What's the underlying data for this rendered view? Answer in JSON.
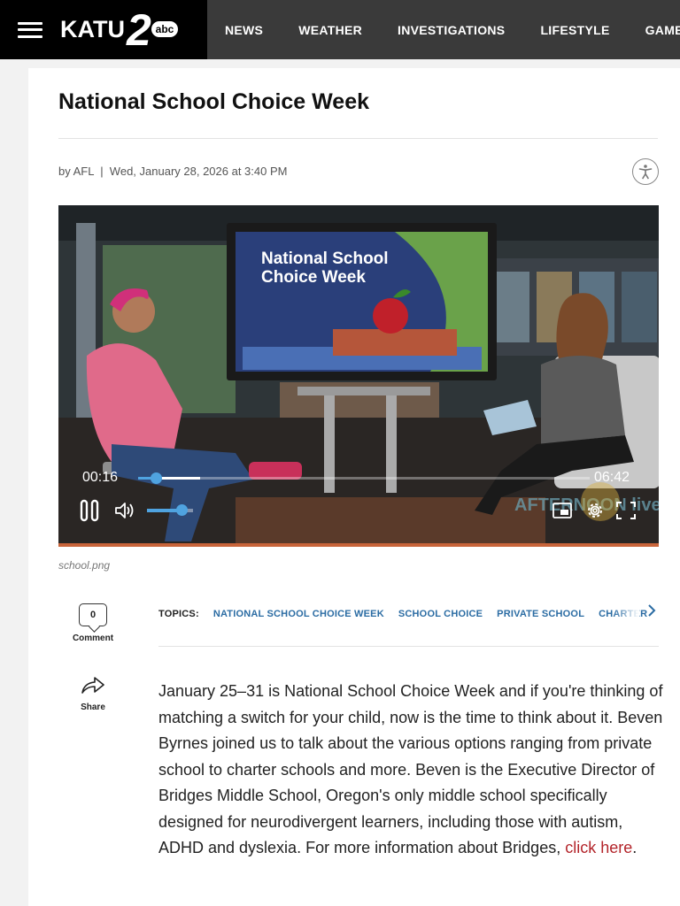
{
  "header": {
    "brand": "KATU",
    "brand_number": "2",
    "brand_network": "abc",
    "nav": [
      "NEWS",
      "WEATHER",
      "INVESTIGATIONS",
      "LIFESTYLE",
      "GAME CEN"
    ]
  },
  "article": {
    "title": "National School Choice Week",
    "byline": "by AFL  |  Wed, January 28, 2026 at 3:40 PM",
    "video": {
      "screen_text_line1": "National School",
      "screen_text_line2": "Choice Week",
      "watermark": "AFTERNOON live",
      "current_time": "00:16",
      "duration": "06:42",
      "progress_fraction": 0.04,
      "volume_fraction": 0.75
    },
    "caption": "school.png",
    "comment_count": "0",
    "comment_label": "Comment",
    "share_label": "Share",
    "topics_label": "TOPICS:",
    "topics": [
      "NATIONAL SCHOOL CHOICE WEEK",
      "SCHOOL CHOICE",
      "PRIVATE SCHOOL",
      "CHARTER"
    ],
    "body_text": "January 25–31 is National School Choice Week and if you're thinking of matching a switch for your child, now is the time to think about it. Beven Byrnes joined us to talk about the various options ranging from private school to charter schools and more. Beven is the Executive Director of Bridges Middle School, Oregon's only middle school specifically designed for neurodivergent learners, including those with autism, ADHD and dyslexia. For more information about Bridges, ",
    "body_link": "click here",
    "body_end": "."
  },
  "colors": {
    "topbar": "#3a3a3a",
    "logo_bg": "#000000",
    "topic_link": "#2b6ca3",
    "body_link": "#b3242a",
    "player_accent": "#4fa3e0"
  }
}
